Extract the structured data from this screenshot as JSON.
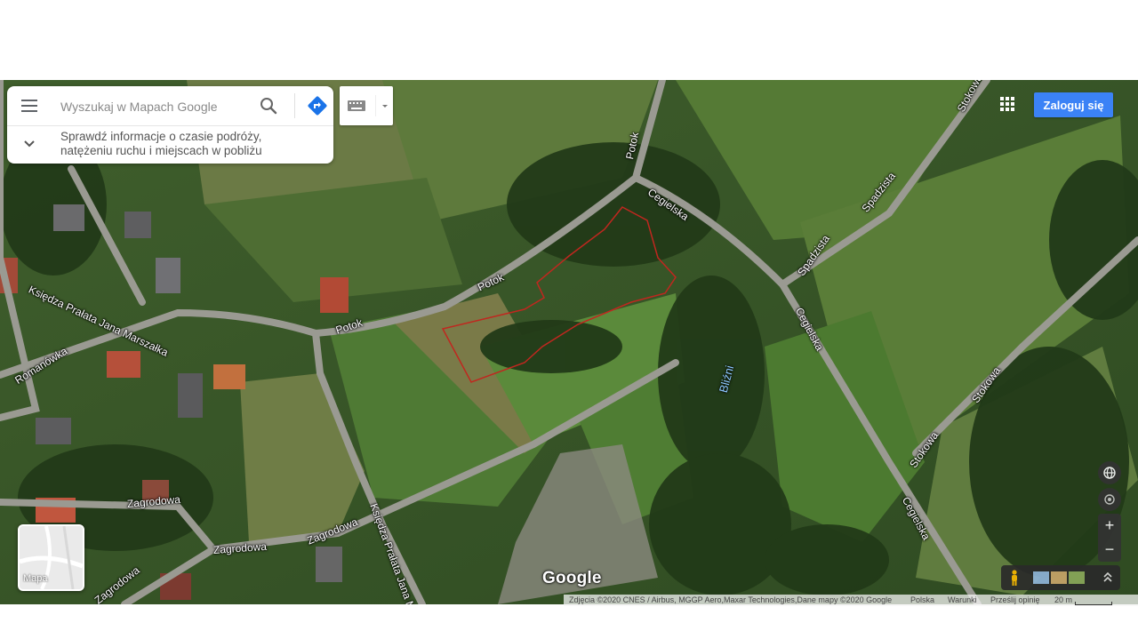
{
  "search": {
    "placeholder": "Wyszukaj w Mapach Google",
    "info_line1": "Sprawdź informacje o czasie podróży,",
    "info_line2": "natężeniu ruchu i miejscach w pobliżu"
  },
  "header": {
    "login_label": "Zaloguj się"
  },
  "map": {
    "streets": [
      "Potok",
      "Potok",
      "Potok",
      "Cegielska",
      "Cegielska",
      "Cegielska",
      "Spadzista",
      "Spadzista",
      "Stokowa",
      "Stokowa",
      "Stokowa",
      "Księdza Prałata Jana Marszałka",
      "Romanówka",
      "Zagrodowa",
      "Zagrodowa",
      "Zagrodowa",
      "Zagrodowa",
      "Księdza Prałata Jana M"
    ],
    "poi": "Bliźni",
    "parcel_outline_color": "#c0271f"
  },
  "minimap": {
    "label": "Mapa"
  },
  "logo": "Google",
  "attribution": {
    "imagery": "Zdjęcia ©2020 CNES / Airbus, MGGP Aero,Maxar Technologies,Dane mapy ©2020 Google",
    "country": "Polska",
    "terms": "Warunki",
    "feedback": "Prześlij opinię",
    "scale": "20 m"
  },
  "colors": {
    "accent": "#3b82f6"
  },
  "icons": [
    "menu-icon",
    "search-icon",
    "directions-icon",
    "chevron-down-icon",
    "keyboard-icon",
    "apps-icon",
    "globe-icon",
    "location-icon",
    "zoom-in-icon",
    "zoom-out-icon",
    "pegman-icon",
    "expand-icon"
  ]
}
